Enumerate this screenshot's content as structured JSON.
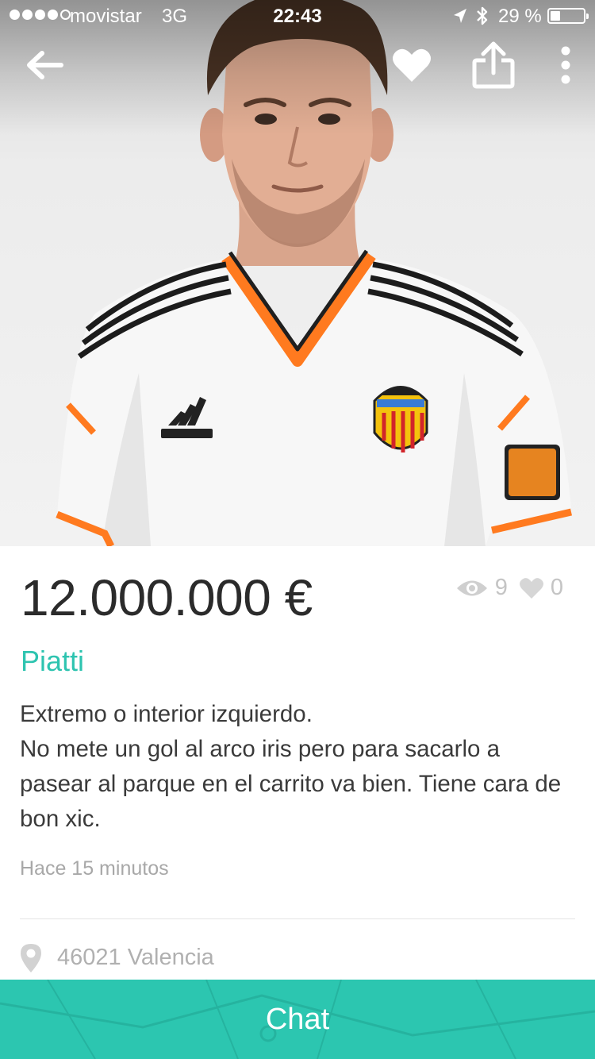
{
  "status_bar": {
    "carrier": "movistar",
    "network": "3G",
    "time": "22:43",
    "battery": "29 %",
    "battery_level": 0.29
  },
  "nav": {
    "back_icon": "arrow-left-icon",
    "favorite_icon": "heart-icon",
    "share_icon": "share-icon",
    "more_icon": "more-vertical-icon"
  },
  "listing": {
    "price": "12.000.000 €",
    "views": "9",
    "favorites": "0",
    "title": "Piatti",
    "description": "Extremo o interior izquierdo.\nNo mete un gol al arco iris pero para sacarlo a pasear al parque en el carrito va bien. Tiene cara de bon xic.",
    "posted": "Hace 15 minutos",
    "location": "46021 Valencia"
  },
  "actions": {
    "chat_label": "Chat"
  },
  "colors": {
    "accent": "#2cc6b0",
    "title_text": "#2ec4b0",
    "price_text": "#2b2b2b"
  }
}
